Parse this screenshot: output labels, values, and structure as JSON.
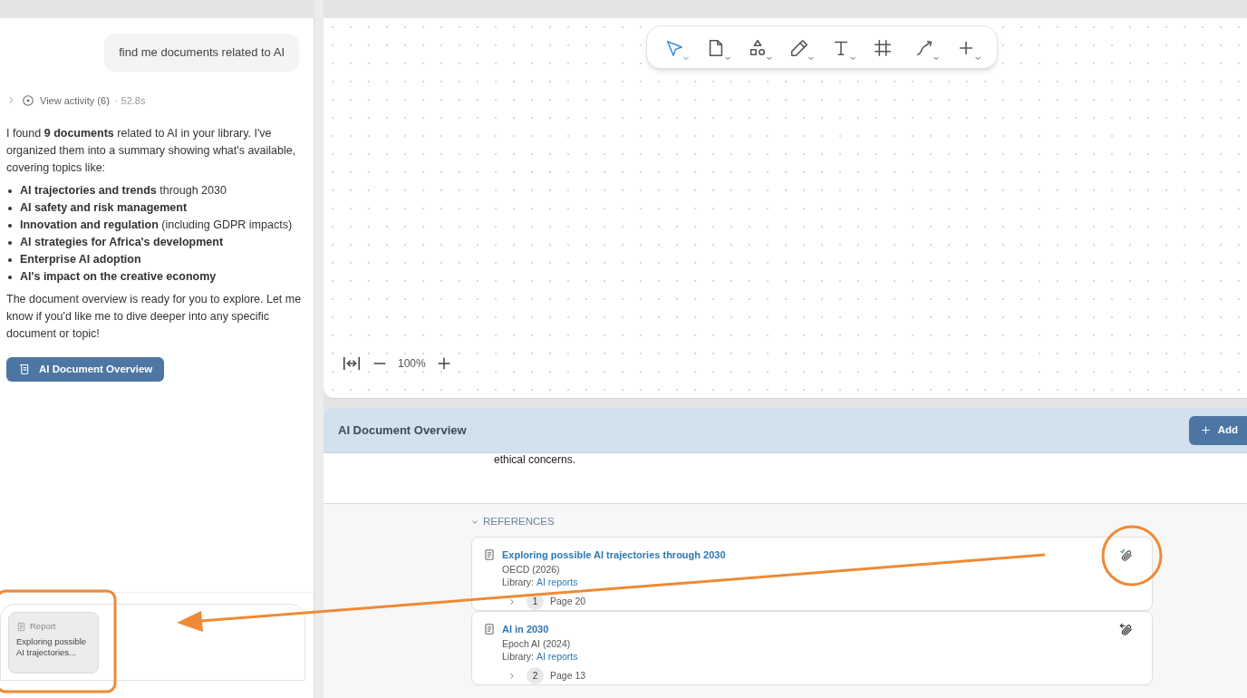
{
  "chat": {
    "user_message": "find me documents related to AI",
    "activity": {
      "label": "View activity (6)",
      "meta": "· 52.8s"
    },
    "intro": "I found **9 documents** related to AI in your library. I've organized them into a summary showing what's available, covering topics like:",
    "topics": [
      "**AI trajectories and trends** through 2030",
      "**AI safety and risk management**",
      "**Innovation and regulation** (including GDPR impacts)",
      "**AI strategies for Africa's development**",
      "**Enterprise AI adoption**",
      "**AI's impact on the creative economy**"
    ],
    "outro": "The document overview is ready for you to explore. Let me know if you'd like me to dive deeper into any specific document or topic!",
    "artifact_button": "AI Document Overview",
    "attachment": {
      "kind_label": "Report",
      "title": "Exploring possible AI trajectories..."
    }
  },
  "canvas": {
    "tools": [
      {
        "kind": "select",
        "selected": true,
        "has_menu": true
      },
      {
        "kind": "page",
        "selected": false,
        "has_menu": true
      },
      {
        "kind": "shapes",
        "selected": false,
        "has_menu": true
      },
      {
        "kind": "pen",
        "selected": false,
        "has_menu": true
      },
      {
        "kind": "text",
        "selected": false,
        "has_menu": true
      },
      {
        "kind": "frame",
        "selected": false,
        "has_menu": false
      },
      {
        "kind": "connector",
        "selected": false,
        "has_menu": true
      },
      {
        "kind": "add",
        "selected": false,
        "has_menu": true
      }
    ],
    "zoom": "100%"
  },
  "overview": {
    "title": "AI Document Overview",
    "add_button": "Add",
    "body_tail": "ethical concerns.",
    "references_label": "REFERENCES",
    "references_expanded": true,
    "references": [
      {
        "title": "Exploring possible AI trajectories through 2030",
        "source": "OECD (2026)",
        "library_label": "Library:",
        "library": "AI reports",
        "citation_number": "1",
        "page": "Page 20",
        "attached": true
      },
      {
        "title": "AI in 2030",
        "source": "Epoch AI (2024)",
        "library_label": "Library:",
        "library": "AI reports",
        "citation_number": "2",
        "page": "Page 13",
        "attached": false
      }
    ]
  }
}
